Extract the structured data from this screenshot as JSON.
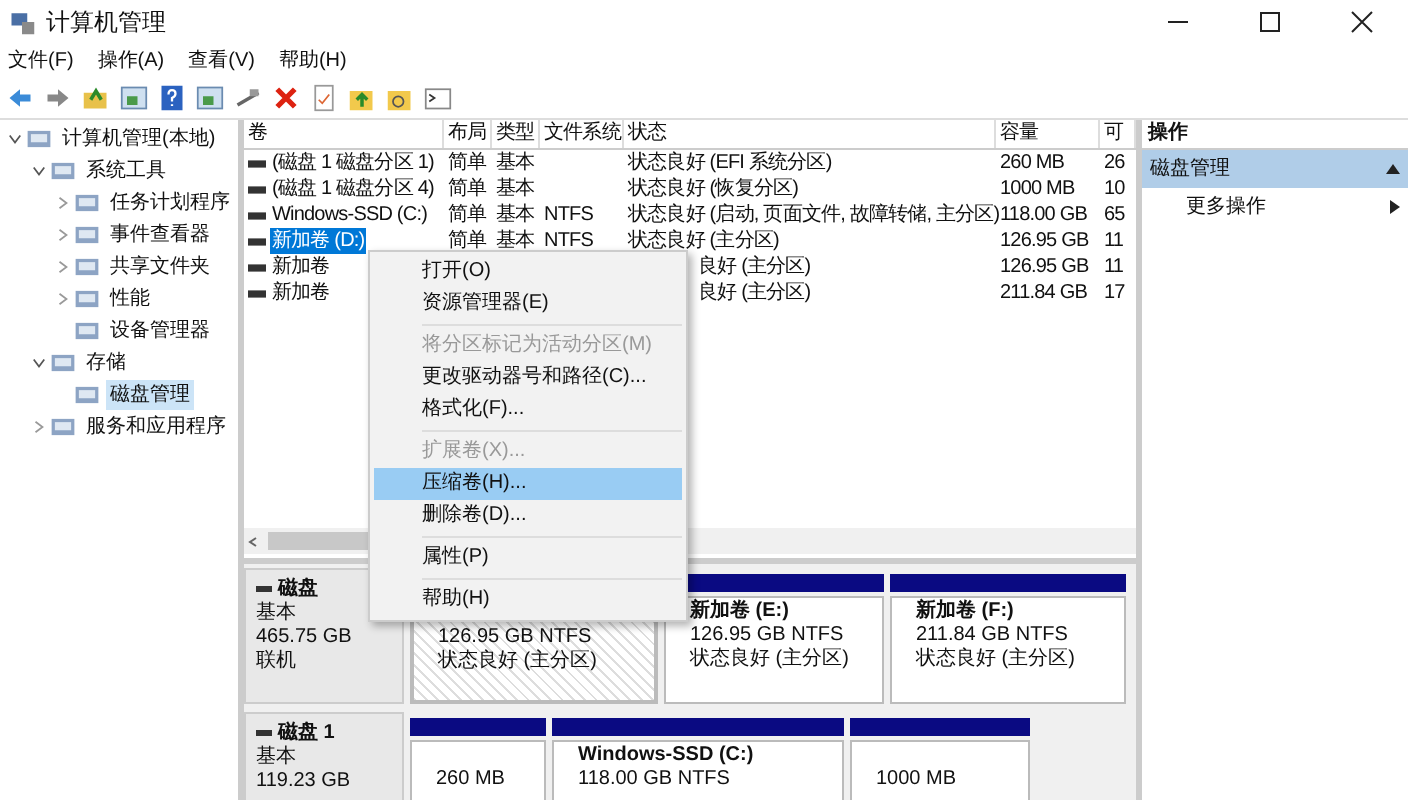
{
  "window": {
    "title": "计算机管理"
  },
  "menu_bar": [
    "文件(F)",
    "操作(A)",
    "查看(V)",
    "帮助(H)"
  ],
  "tree": [
    {
      "label": "计算机管理(本地)",
      "expanded": true,
      "selected": false,
      "children": [
        {
          "label": "系统工具",
          "expanded": true,
          "selected": false,
          "children": [
            {
              "label": "任务计划程序",
              "expanded": false,
              "selected": false
            },
            {
              "label": "事件查看器",
              "expanded": false,
              "selected": false
            },
            {
              "label": "共享文件夹",
              "expanded": false,
              "selected": false
            },
            {
              "label": "性能",
              "expanded": false,
              "selected": false
            },
            {
              "label": "设备管理器",
              "selected": false
            }
          ]
        },
        {
          "label": "存储",
          "expanded": true,
          "selected": false,
          "children": [
            {
              "label": "磁盘管理",
              "selected": true
            }
          ]
        },
        {
          "label": "服务和应用程序",
          "expanded": false,
          "selected": false
        }
      ]
    }
  ],
  "table": {
    "columns": [
      "卷",
      "布局",
      "类型",
      "文件系统",
      "状态",
      "容量",
      "可"
    ],
    "rows": [
      {
        "volume": "(磁盘 1 磁盘分区 1)",
        "layout": "简单",
        "type": "基本",
        "filesystem": "",
        "status": "状态良好 (EFI 系统分区)",
        "capacity": "260 MB",
        "column_7": "26",
        "selected": false
      },
      {
        "volume": "(磁盘 1 磁盘分区 4)",
        "layout": "简单",
        "type": "基本",
        "filesystem": "",
        "status": "状态良好 (恢复分区)",
        "capacity": "1000 MB",
        "column_7": "10",
        "selected": false
      },
      {
        "volume": "Windows-SSD (C:)",
        "layout": "简单",
        "type": "基本",
        "filesystem": "NTFS",
        "status": "状态良好 (启动, 页面文件, 故障转储, 主分区)",
        "capacity": "118.00 GB",
        "column_7": "65",
        "selected": false
      },
      {
        "volume": "新加卷 (D:)",
        "layout": "简单",
        "type": "基本",
        "filesystem": "NTFS",
        "status": "状态良好 (主分区)",
        "capacity": "126.95 GB",
        "column_7": "11",
        "selected": true
      },
      {
        "volume": "新加卷",
        "status": "良好 (主分区)",
        "capacity": "126.95 GB",
        "column_7": "11",
        "selected": false
      },
      {
        "volume": "新加卷",
        "status": "良好 (主分区)",
        "capacity": "211.84 GB",
        "column_7": "17",
        "selected": false
      }
    ]
  },
  "disks": [
    {
      "name": "磁盘",
      "type": "基本",
      "size": "465.75 GB",
      "state": "联机",
      "partitions": [
        {
          "size": "126.95 GB NTFS",
          "status": "状态良好 (主分区)",
          "selected": true
        },
        {
          "name": "新加卷  (E:)",
          "size": "126.95 GB NTFS",
          "status": "状态良好 (主分区)",
          "selected": false
        },
        {
          "name": "新加卷  (F:)",
          "size": "211.84 GB NTFS",
          "status": "状态良好 (主分区)",
          "selected": false
        }
      ]
    },
    {
      "name": "磁盘 1",
      "type": "基本",
      "size": "119.23 GB",
      "partitions": [
        {
          "size": "260 MB",
          "selected": false
        },
        {
          "name": "Windows-SSD  (C:)",
          "size": "118.00 GB NTFS",
          "selected": false
        },
        {
          "size": "1000 MB",
          "selected": false
        }
      ]
    }
  ],
  "context_menu": [
    {
      "kind": "item",
      "label": "打开(O)",
      "disabled": false,
      "selected": false
    },
    {
      "kind": "item",
      "label": "资源管理器(E)",
      "disabled": false,
      "selected": false
    },
    {
      "kind": "separator"
    },
    {
      "kind": "item",
      "label": "将分区标记为活动分区(M)",
      "disabled": true,
      "selected": false
    },
    {
      "kind": "item",
      "label": "更改驱动器号和路径(C)...",
      "disabled": false,
      "selected": false
    },
    {
      "kind": "item",
      "label": "格式化(F)...",
      "disabled": false,
      "selected": false
    },
    {
      "kind": "separator"
    },
    {
      "kind": "item",
      "label": "扩展卷(X)...",
      "disabled": true,
      "selected": false
    },
    {
      "kind": "item",
      "label": "压缩卷(H)...",
      "disabled": false,
      "selected": true
    },
    {
      "kind": "item",
      "label": "删除卷(D)...",
      "disabled": false,
      "selected": false
    },
    {
      "kind": "separator"
    },
    {
      "kind": "item",
      "label": "属性(P)",
      "disabled": false,
      "selected": false
    },
    {
      "kind": "separator"
    },
    {
      "kind": "item",
      "label": "帮助(H)",
      "disabled": false,
      "selected": false
    }
  ],
  "actions": {
    "title": "操作",
    "items": [
      {
        "label": "磁盘管理",
        "kind": "section",
        "selected": true
      },
      {
        "label": "更多操作",
        "kind": "submenu",
        "selected": false
      }
    ]
  }
}
